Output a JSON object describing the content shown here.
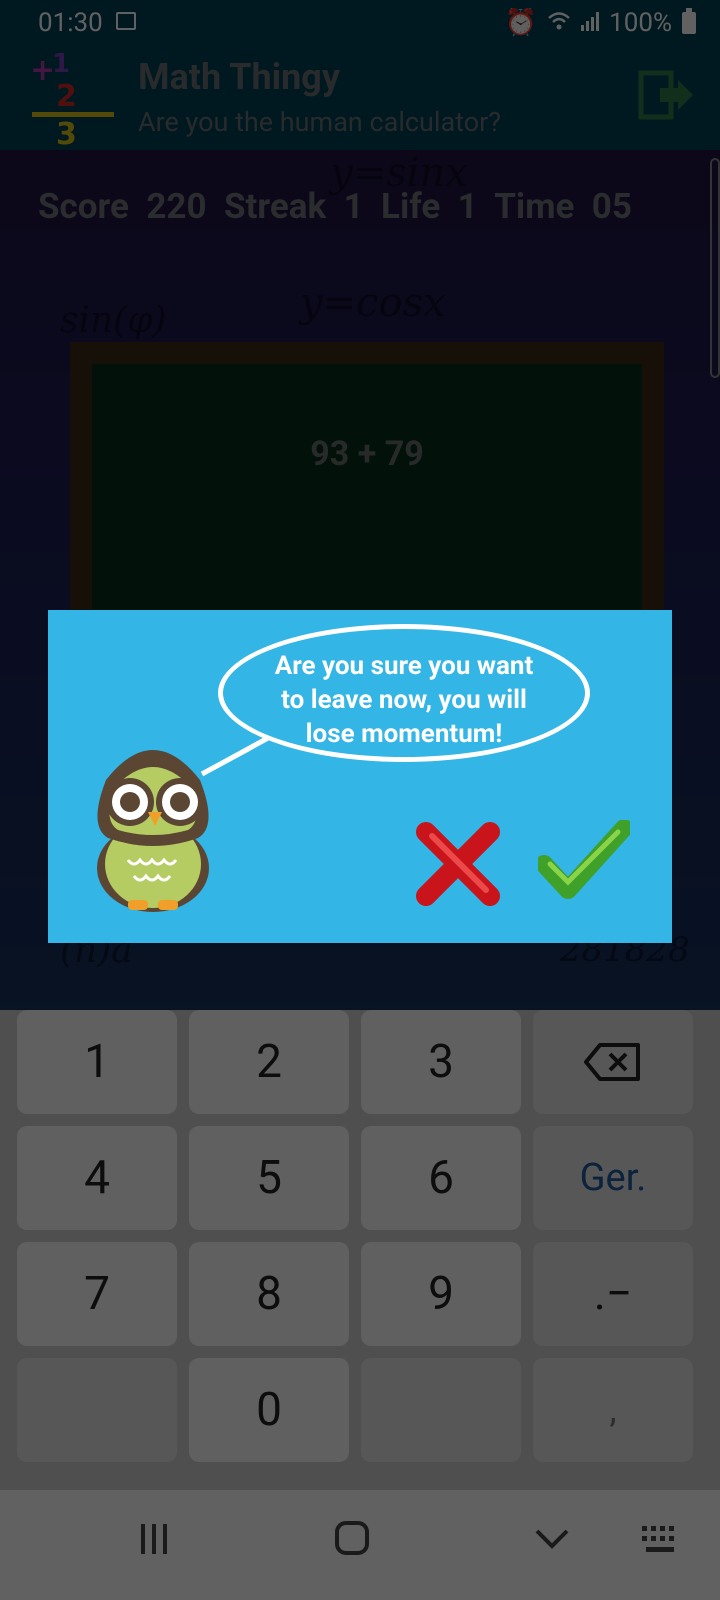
{
  "status": {
    "time": "01:30",
    "battery": "100%"
  },
  "app": {
    "title": "Math Thingy",
    "subtitle": "Are you the human calculator?"
  },
  "scoreboard": {
    "text": "Score  220  Streak  1  Life  1  Time  05"
  },
  "board": {
    "problem": "93 + 79"
  },
  "dialog": {
    "message_line1": "Are you sure you want",
    "message_line2": "to leave now, you will",
    "message_line3": "lose momentum!"
  },
  "keypad": {
    "keys": [
      "1",
      "2",
      "3",
      "4",
      "5",
      "6",
      "7",
      "8",
      "9",
      "0"
    ],
    "go_label": "Ger.",
    "dot_label": ".−",
    "comma_label": ","
  },
  "colors": {
    "appbar": "#013f55",
    "dialog": "#33b5e5",
    "go_key": "#1f5c9e"
  }
}
